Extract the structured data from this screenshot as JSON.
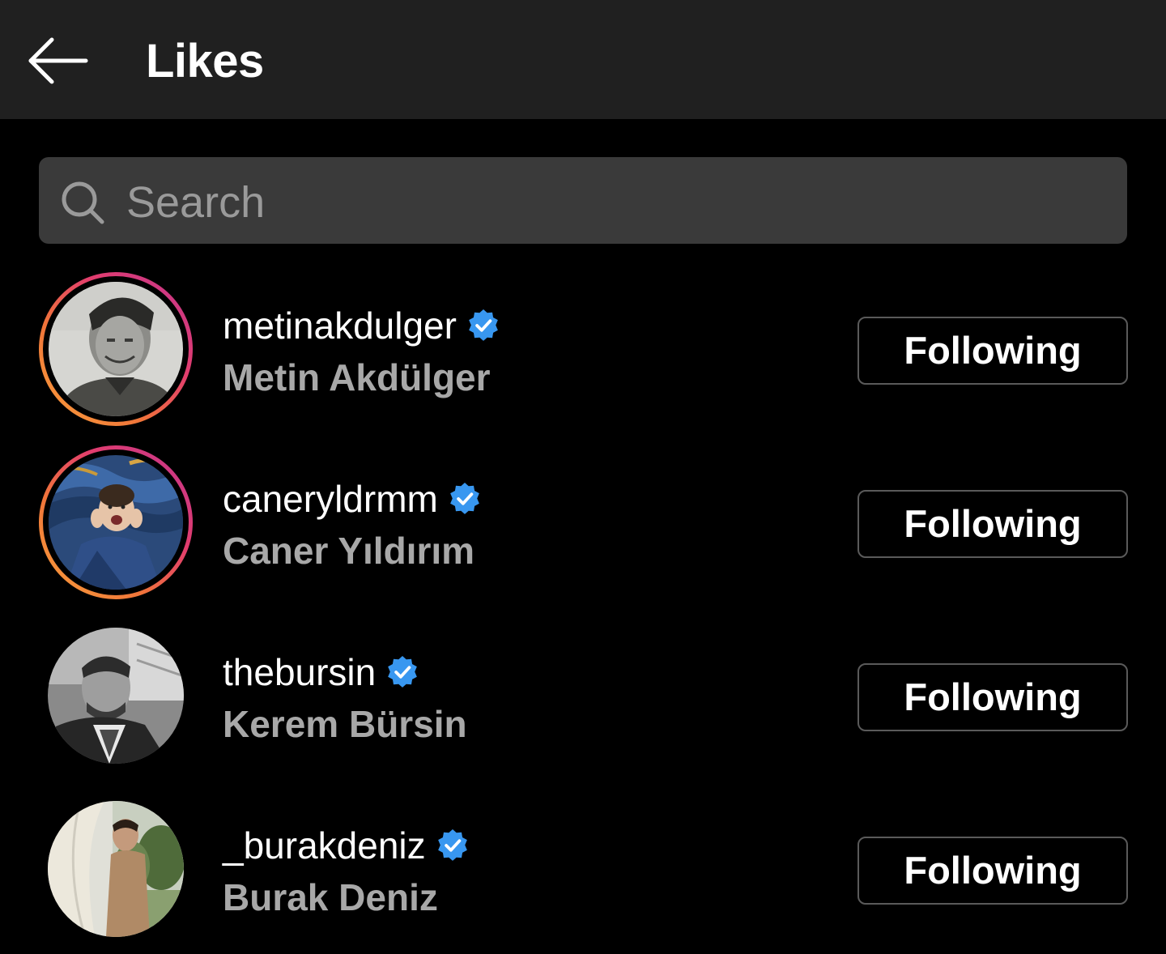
{
  "header": {
    "title": "Likes",
    "back_icon": "arrow-left-icon"
  },
  "search": {
    "placeholder": "Search",
    "icon": "search-icon"
  },
  "colors": {
    "background": "#000000",
    "topbar": "#202020",
    "search_bg": "#3a3a3a",
    "verified": "#3897f0",
    "secondary_text": "#a8a8a8",
    "story_ring_start": "#f9a13a",
    "story_ring_end": "#c1358f"
  },
  "users": [
    {
      "username": "metinakdulger",
      "full_name": "Metin Akdülger",
      "verified": true,
      "has_story": true,
      "button_label": "Following"
    },
    {
      "username": "caneryldrmm",
      "full_name": "Caner Yıldırım",
      "verified": true,
      "has_story": true,
      "button_label": "Following"
    },
    {
      "username": "thebursin",
      "full_name": "Kerem Bürsin",
      "verified": true,
      "has_story": false,
      "button_label": "Following"
    },
    {
      "username": "_burakdeniz",
      "full_name": "Burak Deniz",
      "verified": true,
      "has_story": false,
      "button_label": "Following"
    }
  ]
}
